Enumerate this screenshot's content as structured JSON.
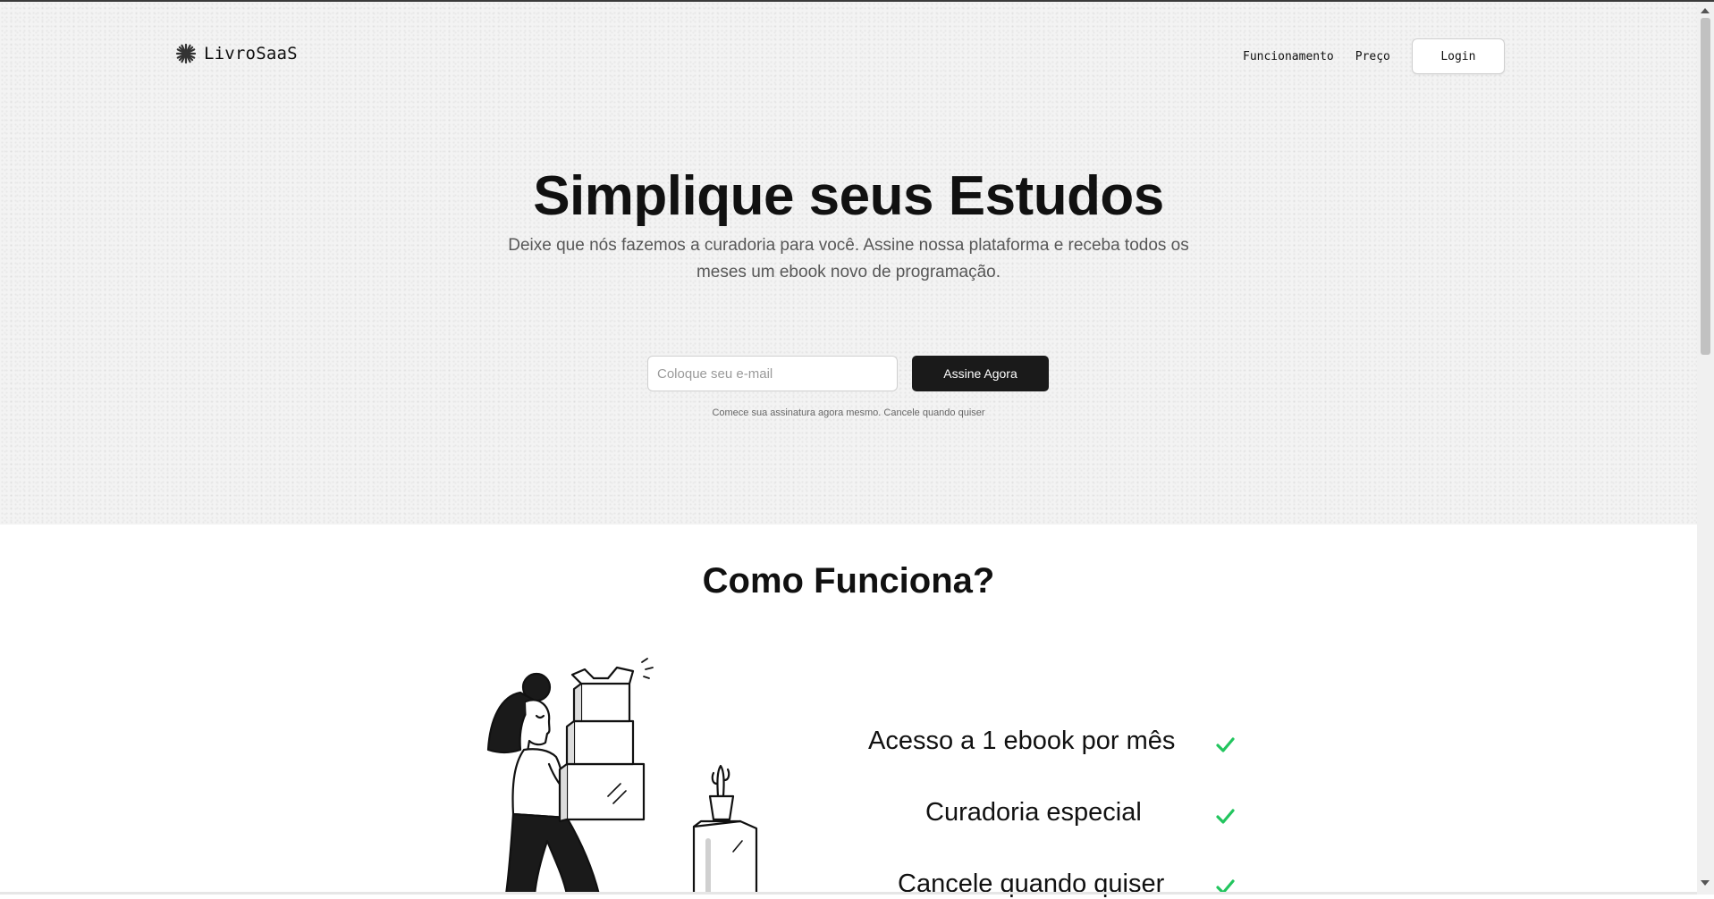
{
  "header": {
    "brand": "LivroSaaS",
    "nav": [
      {
        "label": "Funcionamento"
      },
      {
        "label": "Preço"
      }
    ],
    "login_label": "Login"
  },
  "hero": {
    "title": "Simplique seus Estudos",
    "subtitle": "Deixe que nós fazemos a curadoria para você. Assine nossa plataforma e receba todos os meses um ebook novo de programação.",
    "email_placeholder": "Coloque seu e-mail",
    "cta_label": "Assine Agora",
    "fine_print": "Comece sua assinatura agora mesmo. Cancele quando quiser"
  },
  "how_it_works": {
    "title": "Como Funciona?",
    "features": [
      {
        "label": "Acesso a 1 ebook por mês"
      },
      {
        "label": "Curadoria especial"
      },
      {
        "label": "Cancele quando quiser"
      }
    ],
    "check_color": "#22c55e"
  },
  "icons": {
    "brand": "asterisk-burst-icon",
    "feature_check": "check-icon",
    "illustration": "woman-carrying-boxes-illustration"
  }
}
